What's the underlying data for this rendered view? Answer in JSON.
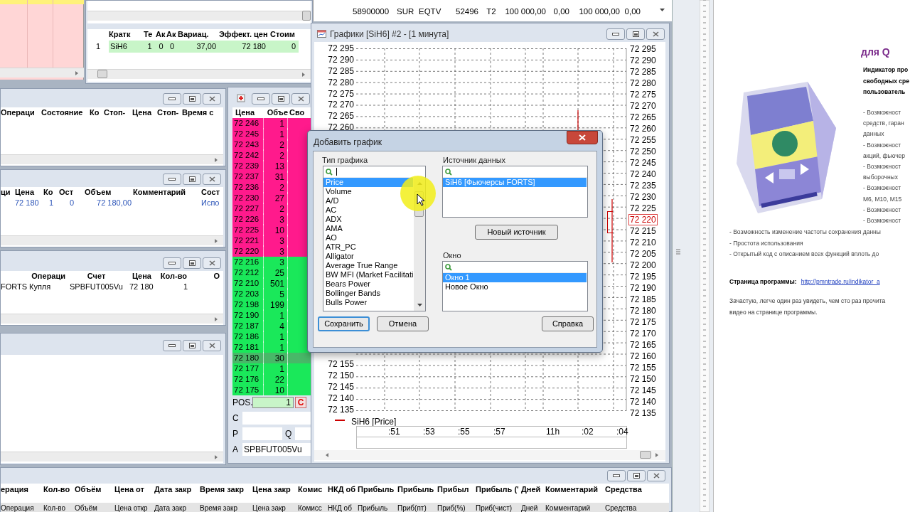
{
  "positions_window": {
    "columns": [
      "",
      "Кратк",
      "Те",
      "Ак",
      "Ак",
      "Вариац.",
      "Эффект. цен",
      "Стоим"
    ],
    "rows": [
      {
        "cells": [
          "1",
          "SiH6",
          "1",
          "0",
          "0",
          "37,00",
          "72 180",
          "0"
        ]
      }
    ]
  },
  "limits_table": {
    "rows": [
      [
        "58900000",
        "SUR",
        "EQTV",
        "52496",
        "T2",
        "100 000,00",
        "0,00",
        "100 000,00",
        "0,00"
      ]
    ]
  },
  "stop_orders_window": {
    "columns": [
      "Операци",
      "Состояние",
      "Ко",
      "Стоп-",
      "Цена",
      "Стоп-",
      "Время с"
    ]
  },
  "orders_window": {
    "columns": [
      "ци",
      "Цена",
      "Ко",
      "Ост",
      "Объем",
      "Комментарий",
      "Сост"
    ],
    "rows": [
      {
        "price": "72 180",
        "qty": "1",
        "rest": "0",
        "volume": "72 180,00",
        "status": "Испо"
      }
    ]
  },
  "deals_window": {
    "columns": [
      "Операци",
      "Счет",
      "Цена",
      "Кол-во",
      "О"
    ],
    "rows": [
      {
        "exchange": "FORTS",
        "operation": "Купля",
        "account": "SPBFUT005Vu",
        "price": "72 180",
        "qty": "1"
      }
    ]
  },
  "order_book": {
    "columns": [
      "Цена",
      "Объе",
      "Сво"
    ],
    "rows": [
      {
        "price": "72 246",
        "volume": "1",
        "kind": "sell",
        "selected": false
      },
      {
        "price": "72 245",
        "volume": "1",
        "kind": "sell",
        "selected": false
      },
      {
        "price": "72 243",
        "volume": "2",
        "kind": "sell",
        "selected": false
      },
      {
        "price": "72 242",
        "volume": "2",
        "kind": "sell",
        "selected": false
      },
      {
        "price": "72 239",
        "volume": "13",
        "kind": "sell",
        "selected": false
      },
      {
        "price": "72 237",
        "volume": "31",
        "kind": "sell",
        "selected": false
      },
      {
        "price": "72 236",
        "volume": "2",
        "kind": "sell",
        "selected": false
      },
      {
        "price": "72 230",
        "volume": "27",
        "kind": "sell",
        "selected": false
      },
      {
        "price": "72 227",
        "volume": "2",
        "kind": "sell",
        "selected": false
      },
      {
        "price": "72 226",
        "volume": "3",
        "kind": "sell",
        "selected": false
      },
      {
        "price": "72 225",
        "volume": "10",
        "kind": "sell",
        "selected": false
      },
      {
        "price": "72 221",
        "volume": "3",
        "kind": "sell",
        "selected": false
      },
      {
        "price": "72 220",
        "volume": "3",
        "kind": "sell",
        "selected": false
      },
      {
        "price": "72 216",
        "volume": "3",
        "kind": "buy",
        "selected": false
      },
      {
        "price": "72 212",
        "volume": "25",
        "kind": "buy",
        "selected": false
      },
      {
        "price": "72 210",
        "volume": "501",
        "kind": "buy",
        "selected": false
      },
      {
        "price": "72 203",
        "volume": "5",
        "kind": "buy",
        "selected": false
      },
      {
        "price": "72 198",
        "volume": "199",
        "kind": "buy",
        "selected": false
      },
      {
        "price": "72 190",
        "volume": "1",
        "kind": "buy",
        "selected": false
      },
      {
        "price": "72 187",
        "volume": "4",
        "kind": "buy",
        "selected": false
      },
      {
        "price": "72 186",
        "volume": "1",
        "kind": "buy",
        "selected": false
      },
      {
        "price": "72 181",
        "volume": "1",
        "kind": "buy",
        "selected": false
      },
      {
        "price": "72 180",
        "volume": "30",
        "kind": "buy",
        "selected": true
      },
      {
        "price": "72 177",
        "volume": "1",
        "kind": "buy",
        "selected": false
      },
      {
        "price": "72 176",
        "volume": "22",
        "kind": "buy",
        "selected": false
      },
      {
        "price": "72 175",
        "volume": "10",
        "kind": "buy",
        "selected": false
      }
    ],
    "pos_label": "POS.",
    "pos_value": "1",
    "cancel_button": "C",
    "comment_label": "C",
    "price_label": "P",
    "qty_label": "Q",
    "account_label": "A",
    "account_value": "SPBFUT005Vu"
  },
  "chart_window": {
    "title": "Графики [SiH6] #2 - [1 минута]",
    "left_labels_top": [
      "72 295",
      "72 290",
      "72 285",
      "72 280",
      "72 275",
      "72 270",
      "72 265",
      "72 260"
    ],
    "left_labels_bottom": [
      "72 155",
      "72 150",
      "72 145",
      "72 140",
      "72 135"
    ],
    "right_labels": [
      {
        "text": "72 295",
        "current": false
      },
      {
        "text": "72 290",
        "current": false
      },
      {
        "text": "72 285",
        "current": false
      },
      {
        "text": "72 280",
        "current": false
      },
      {
        "text": "72 275",
        "current": false
      },
      {
        "text": "72 270",
        "current": false
      },
      {
        "text": "72 265",
        "current": false
      },
      {
        "text": "72 260",
        "current": false
      },
      {
        "text": "72 255",
        "current": false
      },
      {
        "text": "72 250",
        "current": false
      },
      {
        "text": "72 245",
        "current": false
      },
      {
        "text": "72 240",
        "current": false
      },
      {
        "text": "72 235",
        "current": false
      },
      {
        "text": "72 230",
        "current": false
      },
      {
        "text": "72 225",
        "current": false
      },
      {
        "text": "72 220",
        "current": true
      },
      {
        "text": "72 215",
        "current": false
      },
      {
        "text": "72 210",
        "current": false
      },
      {
        "text": "72 205",
        "current": false
      },
      {
        "text": "72 200",
        "current": false
      },
      {
        "text": "72 195",
        "current": false
      },
      {
        "text": "72 190",
        "current": false
      },
      {
        "text": "72 185",
        "current": false
      },
      {
        "text": "72 180",
        "current": false
      },
      {
        "text": "72 175",
        "current": false
      },
      {
        "text": "72 170",
        "current": false
      },
      {
        "text": "72 165",
        "current": false
      },
      {
        "text": "72 160",
        "current": false
      },
      {
        "text": "72 155",
        "current": false
      },
      {
        "text": "72 150",
        "current": false
      },
      {
        "text": "72 145",
        "current": false
      },
      {
        "text": "72 140",
        "current": false
      },
      {
        "text": "72 135",
        "current": false
      }
    ],
    "legend": "SiH6 [Price]",
    "time_labels": [
      ":51",
      ":53",
      ":55",
      ":57",
      "11h",
      ":02",
      ":04"
    ]
  },
  "dialog": {
    "title": "Добавить график",
    "type_group": {
      "label": "Тип графика",
      "items": [
        {
          "label": "Price",
          "selected": true
        },
        {
          "label": "Volume",
          "selected": false
        },
        {
          "label": "A/D",
          "selected": false
        },
        {
          "label": "AC",
          "selected": false
        },
        {
          "label": "ADX",
          "selected": false
        },
        {
          "label": "AMA",
          "selected": false
        },
        {
          "label": "AO",
          "selected": false
        },
        {
          "label": "ATR_PC",
          "selected": false
        },
        {
          "label": "Alligator",
          "selected": false
        },
        {
          "label": "Average True Range",
          "selected": false
        },
        {
          "label": "BW MFI (Market Facilitati",
          "selected": false
        },
        {
          "label": "Bears Power",
          "selected": false
        },
        {
          "label": "Bollinger Bands",
          "selected": false
        },
        {
          "label": "Bulls Power",
          "selected": false
        }
      ]
    },
    "source_group": {
      "label": "Источник данных",
      "items": [
        {
          "label": "SiH6 [Фьючерсы FORTS]",
          "selected": true
        }
      ],
      "button": "Новый источник"
    },
    "window_group": {
      "label": "Окно",
      "items": [
        {
          "label": "Окно 1",
          "selected": true
        },
        {
          "label": "Новое Окно",
          "selected": false
        }
      ]
    },
    "buttons": [
      {
        "label": "Сохранить",
        "default": true
      },
      {
        "label": "Отмена",
        "default": false
      },
      {
        "label": "Справка",
        "default": false
      }
    ]
  },
  "bottom_window": {
    "header_1": [
      "ерация",
      "Кол-во",
      "Объём",
      "Цена от",
      "Дата закр",
      "Время закр",
      "Цена закр",
      "Комис",
      "НКД об",
      "Прибыль",
      "Прибыль",
      "Прибыл",
      "Прибыль ('",
      "Дней",
      "Комментарий",
      "Средства"
    ],
    "header_2": [
      "Операция",
      "Кол-во",
      "Объём",
      "Цена откр",
      "Дата закр",
      "Время закр",
      "Цена закр",
      "Комисс",
      "НКД об",
      "Прибыль",
      "Приб(пт)",
      "Приб(%)",
      "Приб(чист)",
      "Дней",
      "Комментарий",
      "Средства"
    ]
  },
  "document": {
    "title_fragment": "для Q",
    "intro": [
      "Индикатор про",
      "свободных сре",
      "пользователь"
    ],
    "items_short": [
      "- Возможност",
      "средств, гаран",
      "данных",
      "- Возможност",
      "акций, фьючер",
      "- Возможност",
      "выборочных",
      "- Возможност",
      "M6, M10, M15",
      "- Возможност",
      "- Возможност"
    ],
    "items_long": [
      "- Возможность изменение частоты сохранения данны",
      "- Простота использования",
      "- Открытый код с описанием всех функций вплоть до"
    ],
    "link_label": "Страница программы:",
    "link": "http://pmntrade.ru/indikator_a",
    "paragraph": [
      "Зачастую, легче один раз увидеть, чем сто раз прочита",
      "видео на странице программы."
    ]
  }
}
